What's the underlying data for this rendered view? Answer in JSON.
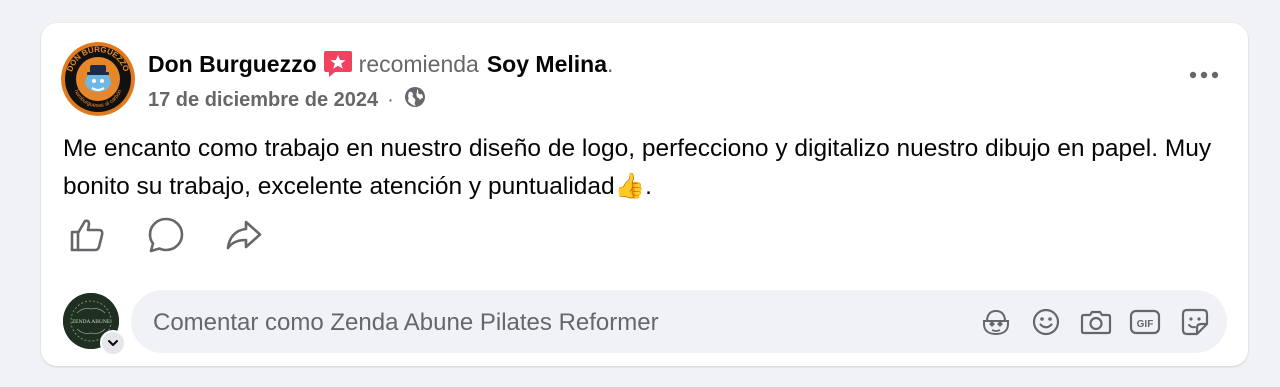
{
  "post": {
    "author": "Don Burguezzo",
    "verb": "recomienda",
    "target": "Soy Melina",
    "period": ".",
    "date": "17 de diciembre de 2024",
    "meta_separator": "·",
    "audience_icon": "globe-icon",
    "text": "Me encanto como trabajo en nuestro diseño de logo, perfecciono y digitalizo nuestro dibujo en papel. Muy bonito su trabajo, excelente atención y puntualidad👍.",
    "avatar_text": "DON BURGUEZZO",
    "avatar_subtext": "hamburguesas al carbón",
    "recommend_icon": "recommendation-star-icon",
    "more_icon": "more-dots-icon"
  },
  "actions": {
    "like_icon": "thumbs-up-icon",
    "comment_icon": "comment-bubble-icon",
    "share_icon": "share-arrow-icon"
  },
  "composer": {
    "placeholder": "Comentar como Zenda Abune Pilates Reformer",
    "avatar_text": "ZENDA ABUNE",
    "icons": [
      "avatar-sticker-icon",
      "emoji-icon",
      "camera-icon",
      "gif-icon",
      "sticker-icon"
    ],
    "gif_label": "GIF"
  },
  "colors": {
    "background": "#f0f2f5",
    "card": "#ffffff",
    "secondary_text": "#65676b",
    "recommend_icon": "#f3425f"
  }
}
